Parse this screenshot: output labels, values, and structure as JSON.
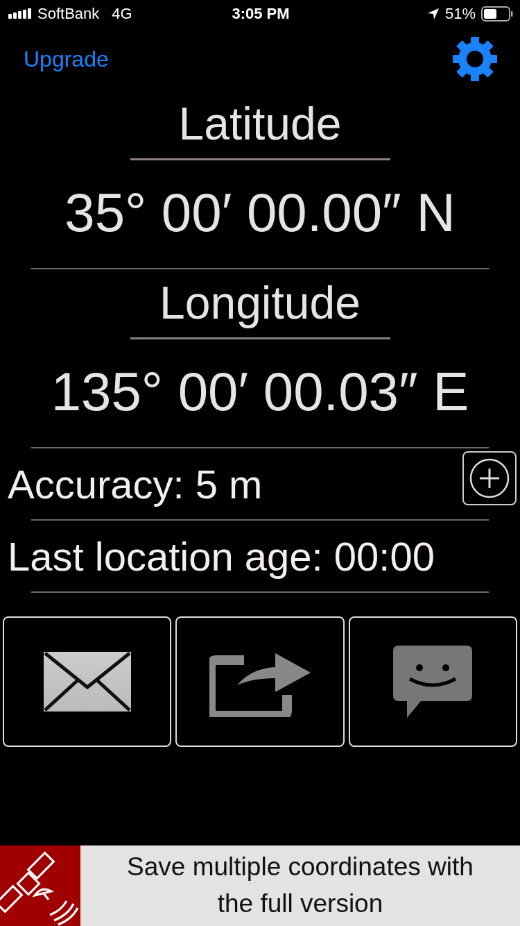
{
  "status_bar": {
    "carrier": "SoftBank",
    "network": "4G",
    "time": "3:05 PM",
    "battery": "51%"
  },
  "nav": {
    "upgrade": "Upgrade"
  },
  "coordinates": [
    {
      "label": "Latitude",
      "value": "35° 00′ 00.00″ N"
    },
    {
      "label": "Longitude",
      "value": "135° 00′ 00.03″ E"
    }
  ],
  "accuracy": "Accuracy: 5 m",
  "age": "Last location age: 00:00",
  "actions": [
    {
      "kind": "mail"
    },
    {
      "kind": "share"
    },
    {
      "kind": "message"
    }
  ],
  "banner": {
    "text": "Save multiple coordinates with the full version"
  }
}
